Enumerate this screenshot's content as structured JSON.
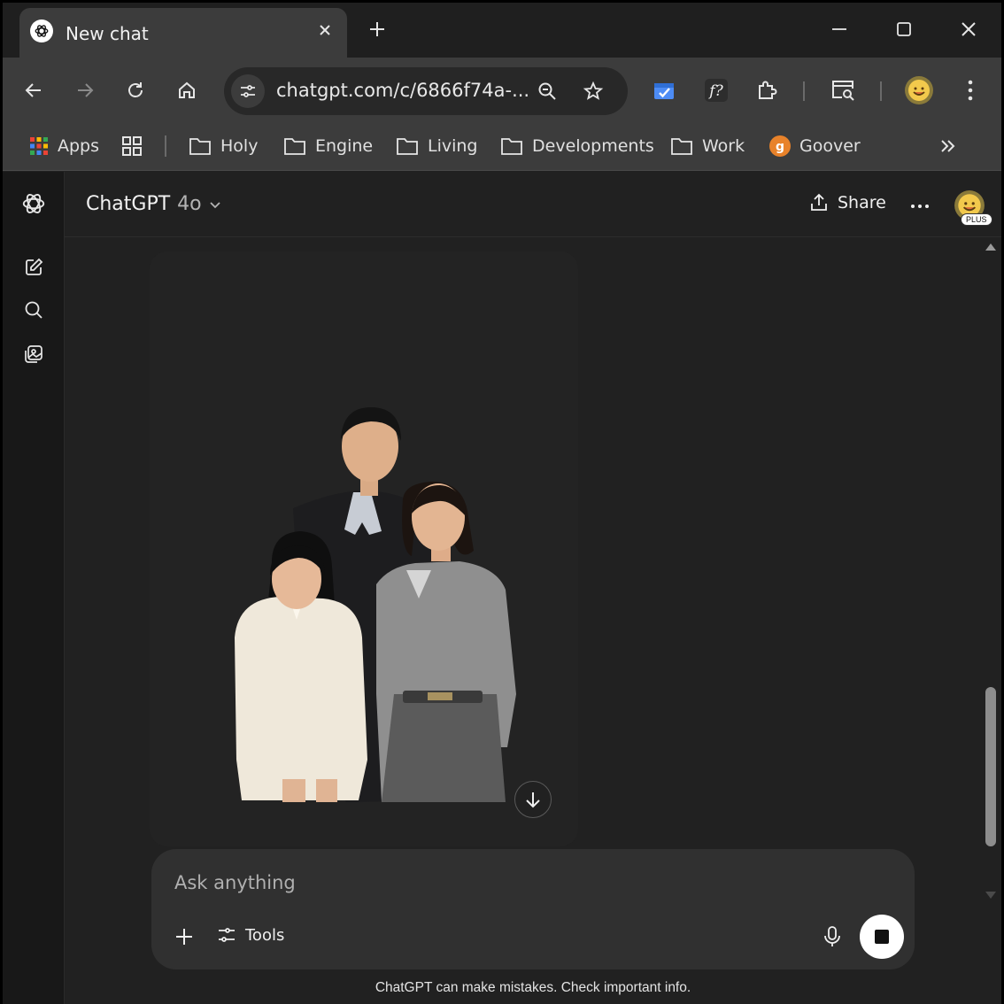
{
  "browser": {
    "tab": {
      "title": "New chat",
      "favicon": "openai-logo-icon"
    },
    "url": "chatgpt.com/c/6866f74a-...",
    "bookmarks": [
      {
        "label": "Apps",
        "icon": "apps-grid-icon"
      },
      {
        "label": "",
        "icon": "tab-groups-icon"
      },
      {
        "label": "Holy",
        "icon": "folder-icon"
      },
      {
        "label": "Engine",
        "icon": "folder-icon"
      },
      {
        "label": "Living",
        "icon": "folder-icon"
      },
      {
        "label": "Developments",
        "icon": "folder-icon"
      },
      {
        "label": "Work",
        "icon": "folder-icon"
      },
      {
        "label": "Goover",
        "icon": "goover-logo-icon"
      }
    ]
  },
  "app": {
    "model_name": "ChatGPT",
    "model_version": "4o",
    "share_label": "Share",
    "plan_badge": "PLUS"
  },
  "composer": {
    "placeholder": "Ask anything",
    "tools_label": "Tools"
  },
  "disclaimer": "ChatGPT can make mistakes. Check important info.",
  "colors": {
    "window_bg": "#212121",
    "chrome_bg": "#3c3c3c",
    "composer_bg": "#303030",
    "accent_blue": "#4d8cf5",
    "goover_orange": "#e8822a"
  }
}
